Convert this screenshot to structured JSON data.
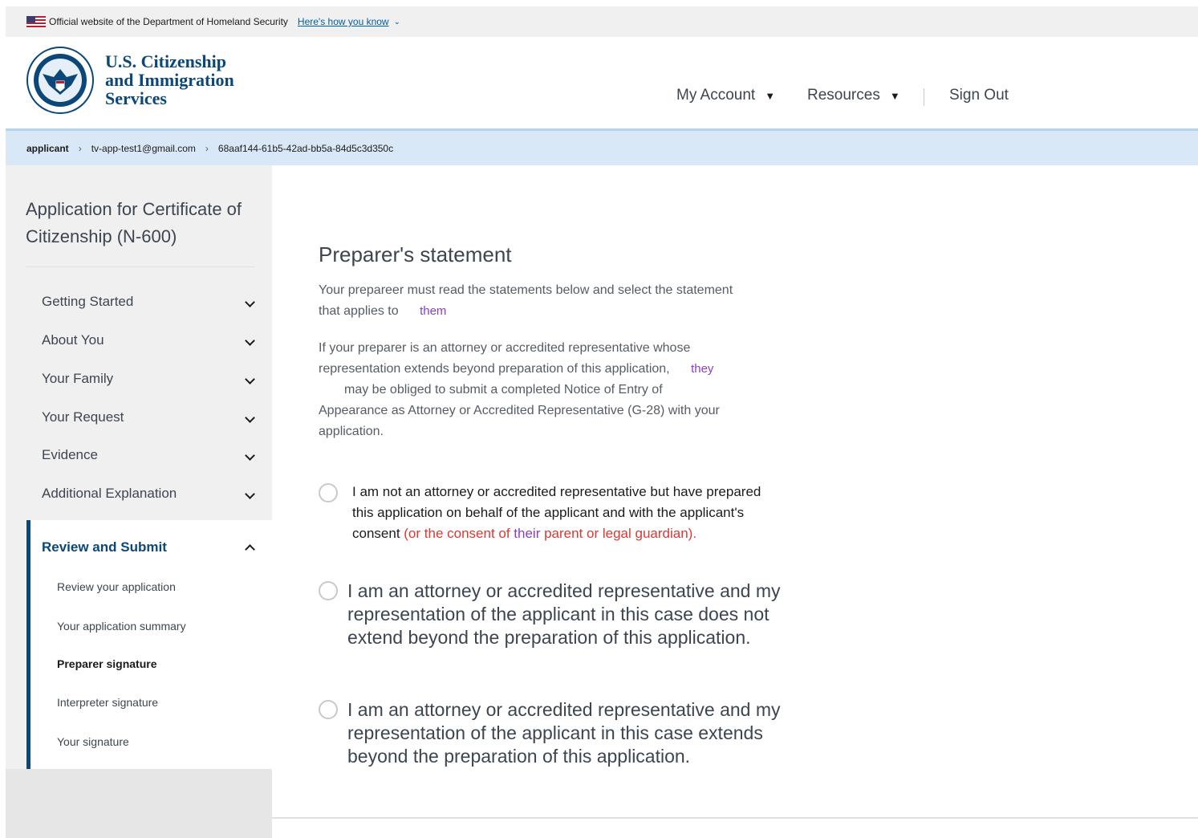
{
  "gov_banner": {
    "text": "Official website of the Department of Homeland Security",
    "link": "Here's how you know"
  },
  "header": {
    "agency_line1": "U.S. Citizenship",
    "agency_line2": "and Immigration",
    "agency_line3": "Services",
    "nav": {
      "my_account": "My Account",
      "resources": "Resources",
      "sign_out": "Sign Out"
    }
  },
  "breadcrumb": {
    "items": [
      "applicant",
      "tv-app-test1@gmail.com",
      "68aaf144-61b5-42ad-bb5a-84d5c3d350c"
    ]
  },
  "sidebar": {
    "title": "Application for Certificate of Citizenship (N-600)",
    "sections": [
      {
        "label": "Getting Started"
      },
      {
        "label": "About You"
      },
      {
        "label": "Your Family"
      },
      {
        "label": "Your Request"
      },
      {
        "label": "Evidence"
      },
      {
        "label": "Additional Explanation"
      }
    ],
    "active_section": {
      "label": "Review and Submit",
      "sub_items": [
        {
          "label": "Review your application"
        },
        {
          "label": "Your application summary"
        },
        {
          "label": "Preparer signature"
        },
        {
          "label": "Interpreter signature"
        },
        {
          "label": "Your signature"
        }
      ]
    }
  },
  "main": {
    "heading": "Preparer's statement",
    "intro": {
      "line1": "Your prepareer must read the statements below and select the statement",
      "line2": "that applies to",
      "insert": "them"
    },
    "attorney_note": {
      "line1": "If your preparer is an attorney or accredited representative whose",
      "line2": "representation extends beyond preparation of this application,",
      "insert": "they",
      "line3": "may be obliged to submit a completed Notice of Entry of",
      "line4": "Appearance as Attorney or Accredited Representative (G-28) with your",
      "line5": "application."
    },
    "options": [
      {
        "text_plain": "I am not an attorney or accredited representative but have prepared this application on behalf of the applicant and with the applicant's consent ",
        "text_red_1": "(or the consent of ",
        "text_purple": "their",
        "text_red_2": " parent or legal guardian)."
      },
      {
        "text": "I am an attorney or accredited representative and my representation of the applicant in this case does not extend beyond the preparation of this application."
      },
      {
        "text": "I am an attorney or accredited representative and my representation of the applicant in this case extends beyond the preparation of this application."
      }
    ]
  },
  "colors": {
    "brand_navy": "#0b4778",
    "breadcrumb_bg": "#d9e8f6",
    "sidebar_bg": "#f0f0f0",
    "annotation_red": "#d83933",
    "annotation_purple": "#8a3fc7"
  }
}
